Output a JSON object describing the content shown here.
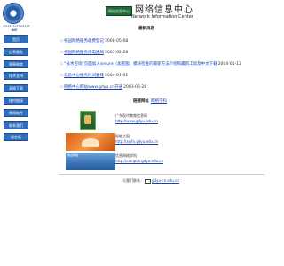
{
  "header": {
    "logo_subtitle": "1111111111111111",
    "logo_abbr": "NIC",
    "banner_text": "网络信息中心",
    "title_cn": "网络信息中心",
    "title_en": "Network Information Center"
  },
  "sidebar": {
    "items": [
      {
        "label": "首页"
      },
      {
        "label": "信息服务"
      },
      {
        "label": "规章制度"
      },
      {
        "label": "技术支持"
      },
      {
        "label": "表格下载"
      },
      {
        "label": "校内链接"
      },
      {
        "label": "常用软件"
      },
      {
        "label": "联系我们"
      },
      {
        "label": "留言板"
      }
    ]
  },
  "news": {
    "title": "最新消息",
    "items": [
      {
        "text": "校园网络服务收费登记",
        "date": "2008-05-08"
      },
      {
        "text": "校园网络服务停电通知",
        "date": "2007-02-28"
      },
      {
        "text": "“技术咨询”页面加入secure（加密版）模块检查的最新方法介绍和最新工具及中文下载",
        "date": "2004-05-12"
      },
      {
        "text": "信息中心服务时间安排",
        "date": "2004-01-01"
      },
      {
        "text": "网络中心网站www.gdyu.cn开通",
        "date": "2003-06-26"
      }
    ]
  },
  "links": {
    "heading": "链接网址",
    "heading_link": "网络学科",
    "items": [
      {
        "title": "广东现代教育信息网",
        "url": "http://www.gdyu.edu.cn"
      },
      {
        "title": "智能之窗",
        "url": "http://aiyfx.gdyu.edu.cn"
      },
      {
        "title": "信息网络学科",
        "url": "http://campus.gdyu.edu.cn"
      }
    ],
    "thumb_caption": "信息网络"
  },
  "footer": {
    "label": "与我们联系：",
    "email": "gdyu-cn.edu.cn"
  },
  "colors": {
    "nav_bg": "#2f6ebe",
    "link": "#1a3fb0",
    "banner": "#1e6a3a"
  }
}
